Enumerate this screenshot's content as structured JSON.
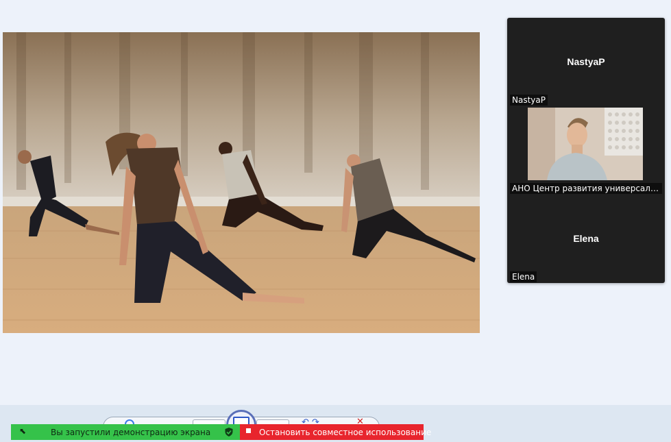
{
  "shared_screen": {
    "content": "dance-studio-photo"
  },
  "participants": [
    {
      "display_name": "NastyaP",
      "caption": "NastyaP",
      "video_on": false
    },
    {
      "caption": "АНО Центр развития универсальн...",
      "video_on": true
    },
    {
      "display_name": "Elena",
      "caption": "Elena",
      "video_on": false
    }
  ],
  "share_banner": {
    "message": "Вы запустили демонстрацию экрана",
    "icon": "pin-icon",
    "security_icon": "shield-check-icon",
    "color": "#35c24a"
  },
  "stop_share": {
    "label": "Остановить совместное использование",
    "icon": "stop-icon",
    "color": "#e8252d"
  }
}
